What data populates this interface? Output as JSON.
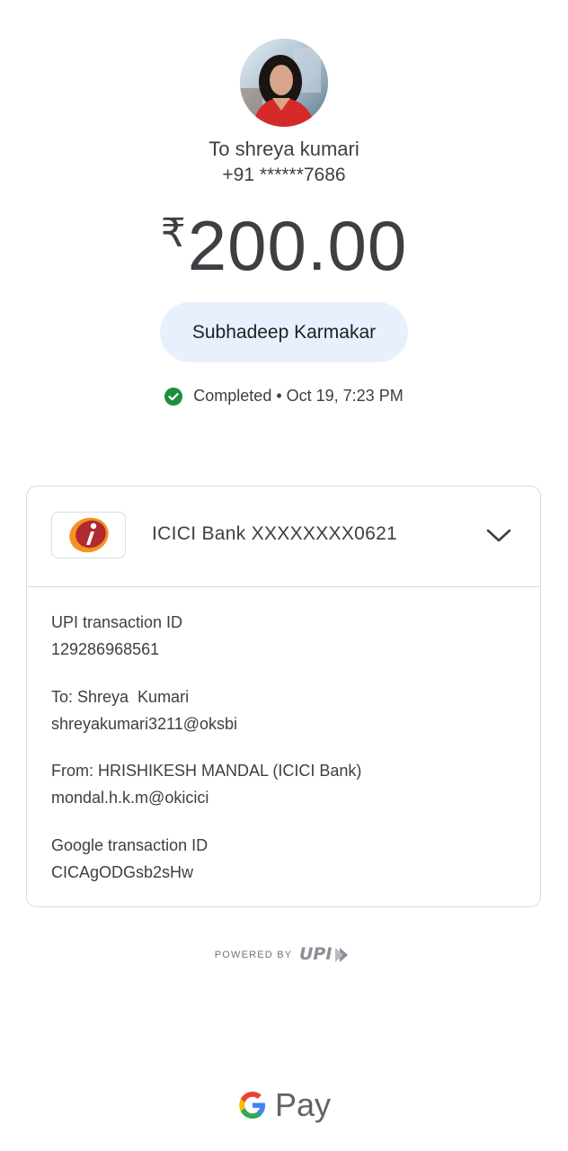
{
  "recipient": {
    "to_line": "To shreya kumari",
    "phone": "+91 ******7686"
  },
  "payment": {
    "currency_symbol": "₹",
    "amount": "200.00",
    "note": "Subhadeep Karmakar",
    "status": "Completed • Oct 19, 7:23 PM",
    "status_color": "#1e8e3e"
  },
  "account": {
    "bank_label": "ICICI Bank XXXXXXXX0621",
    "bank_logo_icon": "icici-bank-logo",
    "expand_icon": "chevron-down-icon"
  },
  "details": {
    "upi_id_label": "UPI transaction ID",
    "upi_id_value": "129286968561",
    "to_label": "To: Shreya  Kumari",
    "to_value": "shreyakumari3211@oksbi",
    "from_label": "From: HRISHIKESH MANDAL (ICICI Bank)",
    "from_value": "mondal.h.k.m@okicici",
    "google_id_label": "Google transaction ID",
    "google_id_value": "CICAgODGsb2sHw"
  },
  "footer": {
    "powered_by": "POWERED BY",
    "upi_logo": "UPI",
    "pay_text": "Pay"
  },
  "colors": {
    "pill_bg": "#e8f0fe",
    "border": "#dadce0",
    "text": "#3c4043"
  }
}
